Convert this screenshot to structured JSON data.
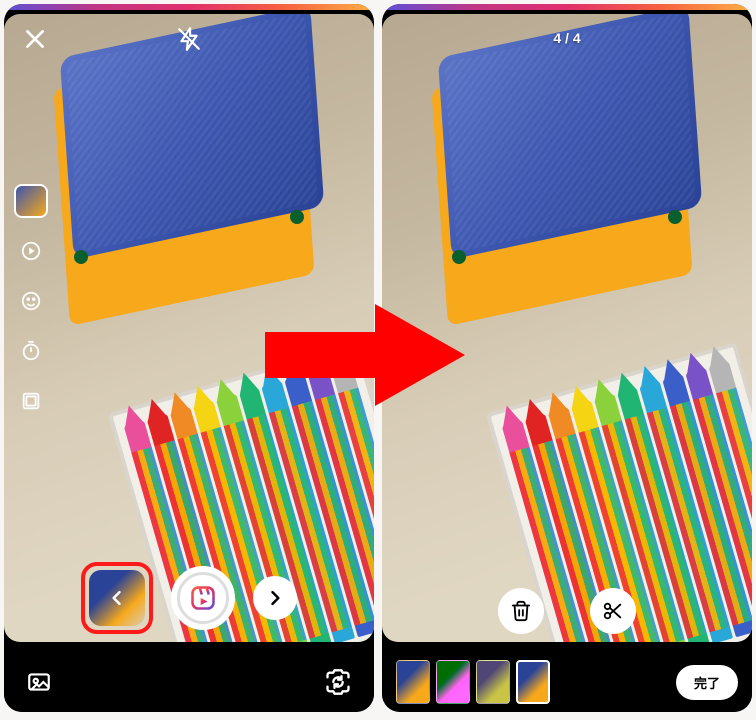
{
  "left": {
    "side_rail_icons": [
      "boomerang-icon",
      "sparkle-icon",
      "timer-icon",
      "layout-icon"
    ]
  },
  "right": {
    "counter": "4 / 4",
    "done_label": "完了",
    "thumb_count": 4,
    "selected_thumb_index": 3
  },
  "colors": {
    "accent_red": "#ff1a1a",
    "arrow_red": "#ff0000"
  },
  "crayon_tips": [
    "#e94f9b",
    "#e02424",
    "#f08a24",
    "#f5d414",
    "#8bd13c",
    "#21b573",
    "#2aa7d9",
    "#3b5fc9",
    "#7a52c7",
    "#b5b5b5"
  ]
}
